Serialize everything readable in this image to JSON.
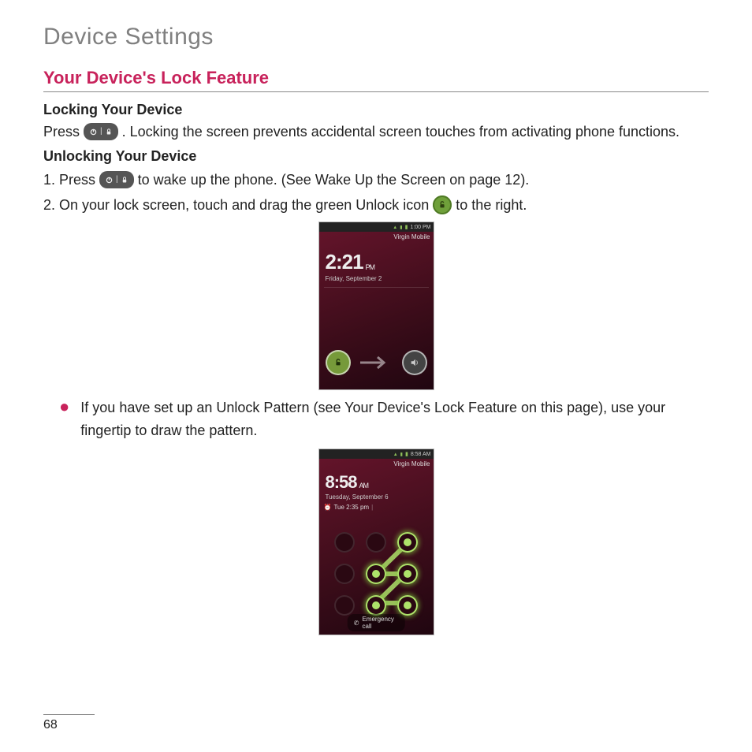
{
  "chapter_title": "Device Settings",
  "section_title": "Your Device's Lock Feature",
  "sub1": "Locking Your Device",
  "p1a": "Press ",
  "p1b": ". Locking the screen prevents accidental screen touches from activating phone functions.",
  "sub2": "Unlocking Your Device",
  "step1a": "1. Press ",
  "step1b": " to wake up the phone. (See Wake Up the Screen on page 12).",
  "step2a": "2. On your lock screen, touch and drag the green Unlock icon ",
  "step2b": " to the right.",
  "bullet1": "If you have set up an Unlock Pattern (see Your Device's Lock Feature on this page), use your fingertip to draw the pattern.",
  "page_number": "68",
  "screenshot1": {
    "statusbar_time": "1:00 PM",
    "carrier": "Virgin Mobile",
    "clock_time": "2:21",
    "clock_ampm": "PM",
    "clock_date": "Friday, September 2"
  },
  "screenshot2": {
    "statusbar_time": "8:58 AM",
    "carrier": "Virgin Mobile",
    "clock_time": "8:58",
    "clock_ampm": "AM",
    "clock_date": "Tuesday, September 6",
    "alarm": "Tue 2:35 pm",
    "emergency_label": "Emergency call"
  }
}
